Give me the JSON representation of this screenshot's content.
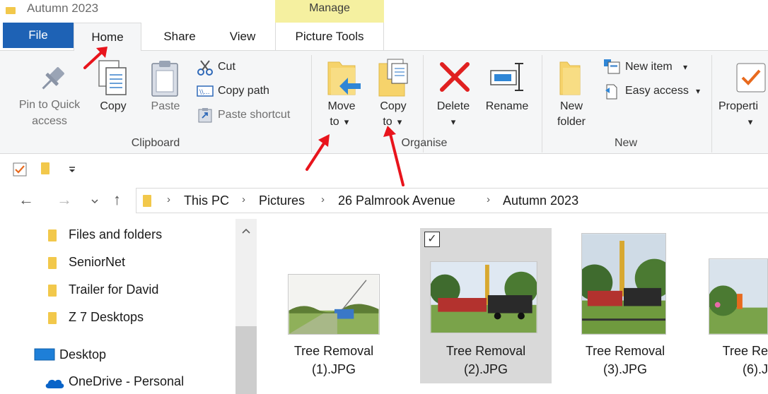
{
  "window": {
    "title": "Autumn 2023",
    "contextual_group": "Manage"
  },
  "tabs": {
    "file": "File",
    "home": "Home",
    "share": "Share",
    "view": "View",
    "picture_tools": "Picture Tools"
  },
  "ribbon": {
    "clipboard": {
      "group_label": "Clipboard",
      "pin_line1": "Pin to Quick",
      "pin_line2": "access",
      "copy": "Copy",
      "paste": "Paste",
      "cut": "Cut",
      "copy_path": "Copy path",
      "paste_shortcut": "Paste shortcut"
    },
    "organise": {
      "group_label": "Organise",
      "move_line1": "Move",
      "move_line2": "to",
      "copy_line1": "Copy",
      "copy_line2": "to",
      "delete": "Delete",
      "rename": "Rename"
    },
    "new": {
      "group_label": "New",
      "new_folder_line1": "New",
      "new_folder_line2": "folder",
      "new_item": "New item",
      "easy_access": "Easy access"
    },
    "open": {
      "properties": "Properti"
    },
    "dropdown_glyph": "▾"
  },
  "address_bar": {
    "crumbs": [
      "This PC",
      "Pictures",
      "26 Palmrook Avenue",
      "Autumn 2023"
    ],
    "separator": "›"
  },
  "nav_pane": {
    "items": [
      "Files and folders",
      "SeniorNet",
      "Trailer for David",
      "Z 7 Desktops"
    ],
    "desktop": "Desktop",
    "onedrive": "OneDrive - Personal"
  },
  "files": [
    {
      "line1": "Tree Removal",
      "line2": "(1).JPG",
      "selected": false
    },
    {
      "line1": "Tree Removal",
      "line2": "(2).JPG",
      "selected": true
    },
    {
      "line1": "Tree Removal",
      "line2": "(3).JPG",
      "selected": false
    },
    {
      "line1": "Tree Re",
      "line2": "(6).J",
      "selected": false
    }
  ],
  "colors": {
    "file_tab": "#1e62b5",
    "manage_highlight": "#f5f0a0",
    "folder": "#f2c84b",
    "delete_x": "#e02020",
    "annotation_arrow": "#e8141c",
    "selection": "#d9d9d9"
  }
}
